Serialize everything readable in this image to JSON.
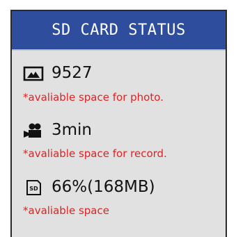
{
  "header": {
    "title": "SD CARD STATUS"
  },
  "items": [
    {
      "icon": "photo-icon",
      "value": "9527",
      "note": "*avaliable space for photo."
    },
    {
      "icon": "video-camera-icon",
      "value": "3min",
      "note": "*avaliable space for record."
    },
    {
      "icon": "sd-card-icon",
      "icon_text": "SD",
      "value": "66%(168MB)",
      "note": "*avaliable space"
    }
  ],
  "colors": {
    "header_bg": "#2e4d9c",
    "panel_bg": "#e1e1e1",
    "note_text": "#e02222"
  }
}
